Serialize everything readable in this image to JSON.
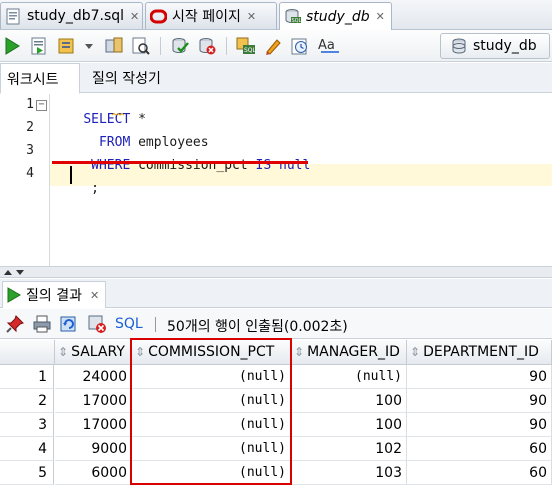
{
  "doc_tabs": [
    {
      "label": "study_db7.sql",
      "close": "✕",
      "icon": "sql-file-icon"
    },
    {
      "label": "시작 페이지",
      "close": "✕",
      "icon": "oracle-start-icon"
    },
    {
      "label": "study_db",
      "close": "✕",
      "icon": "sql-worksheet-icon"
    }
  ],
  "toolbar": {
    "icons": [
      "run-statement-icon",
      "run-script-icon",
      "autotrace-icon",
      "dropdown-arrow-icon",
      "explain-plan-icon",
      "sql-tuning-icon",
      "commit-icon",
      "rollback-icon",
      "unshared-sql-icon",
      "clear-icon",
      "history-icon",
      "format-text-icon"
    ],
    "connection": "study_db"
  },
  "sub_tabs": [
    "워크시트",
    "질의 작성기"
  ],
  "editor": {
    "line_numbers": [
      "1",
      "2",
      "3",
      "4"
    ],
    "lines": [
      [
        {
          "t": "SELECT",
          "c": "kw"
        },
        {
          "t": " *",
          "c": "id"
        }
      ],
      [
        {
          "t": "  FROM",
          "c": "kw"
        },
        {
          "t": " employees",
          "c": "id"
        }
      ],
      [
        {
          "t": " WHERE",
          "c": "kw"
        },
        {
          "t": " commission_pct ",
          "c": "id"
        },
        {
          "t": "IS",
          "c": "kw"
        },
        {
          "t": " null",
          "c": "kw"
        }
      ],
      [
        {
          "t": " ;",
          "c": "id"
        }
      ]
    ]
  },
  "results": {
    "tab_label": "질의 결과",
    "tab_close": "✕",
    "sql_link": "SQL",
    "status": "50개의 행이 인출됨(0.002초)",
    "columns": [
      "SALARY",
      "COMMISSION_PCT",
      "MANAGER_ID",
      "DEPARTMENT_ID"
    ],
    "rows": [
      {
        "n": "1",
        "cells": [
          "24000",
          "(null)",
          "(null)",
          "90"
        ]
      },
      {
        "n": "2",
        "cells": [
          "17000",
          "(null)",
          "100",
          "90"
        ]
      },
      {
        "n": "3",
        "cells": [
          "17000",
          "(null)",
          "100",
          "90"
        ]
      },
      {
        "n": "4",
        "cells": [
          "9000",
          "(null)",
          "102",
          "60"
        ]
      },
      {
        "n": "5",
        "cells": [
          "6000",
          "(null)",
          "103",
          "60"
        ]
      }
    ]
  },
  "colors": {
    "keyword": "#1e22b8",
    "highlight": "#e00000",
    "current_line": "#fff8d9"
  }
}
